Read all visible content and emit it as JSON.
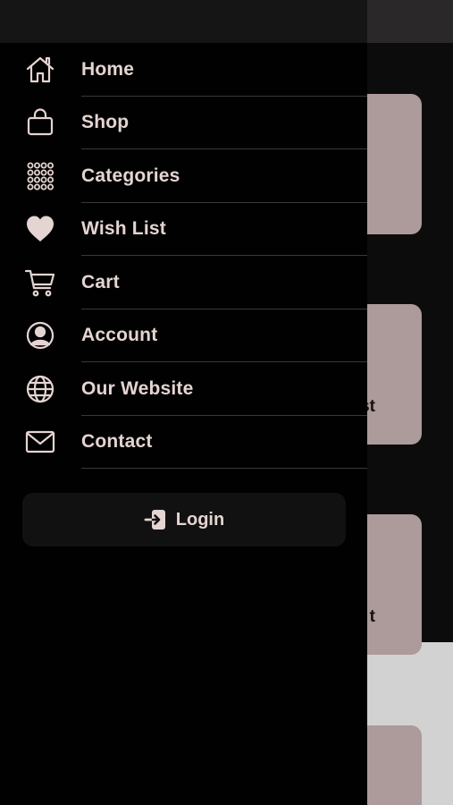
{
  "background": {
    "card_peek_texts": [
      "st",
      "t"
    ]
  },
  "menu": {
    "items": [
      {
        "label": "Home",
        "icon": "home-icon"
      },
      {
        "label": "Shop",
        "icon": "bag-icon"
      },
      {
        "label": "Categories",
        "icon": "grid-dots-icon"
      },
      {
        "label": "Wish List",
        "icon": "heart-icon"
      },
      {
        "label": "Cart",
        "icon": "cart-icon"
      },
      {
        "label": "Account",
        "icon": "user-circle-icon"
      },
      {
        "label": "Our Website",
        "icon": "globe-icon"
      },
      {
        "label": "Contact",
        "icon": "envelope-icon"
      }
    ]
  },
  "login": {
    "label": "Login",
    "icon": "sign-in-icon"
  },
  "colors": {
    "drawer_bg": "#010101",
    "accent": "#e4d4d2",
    "card_bg": "#ad9a9a",
    "divider": "#3b3838"
  }
}
